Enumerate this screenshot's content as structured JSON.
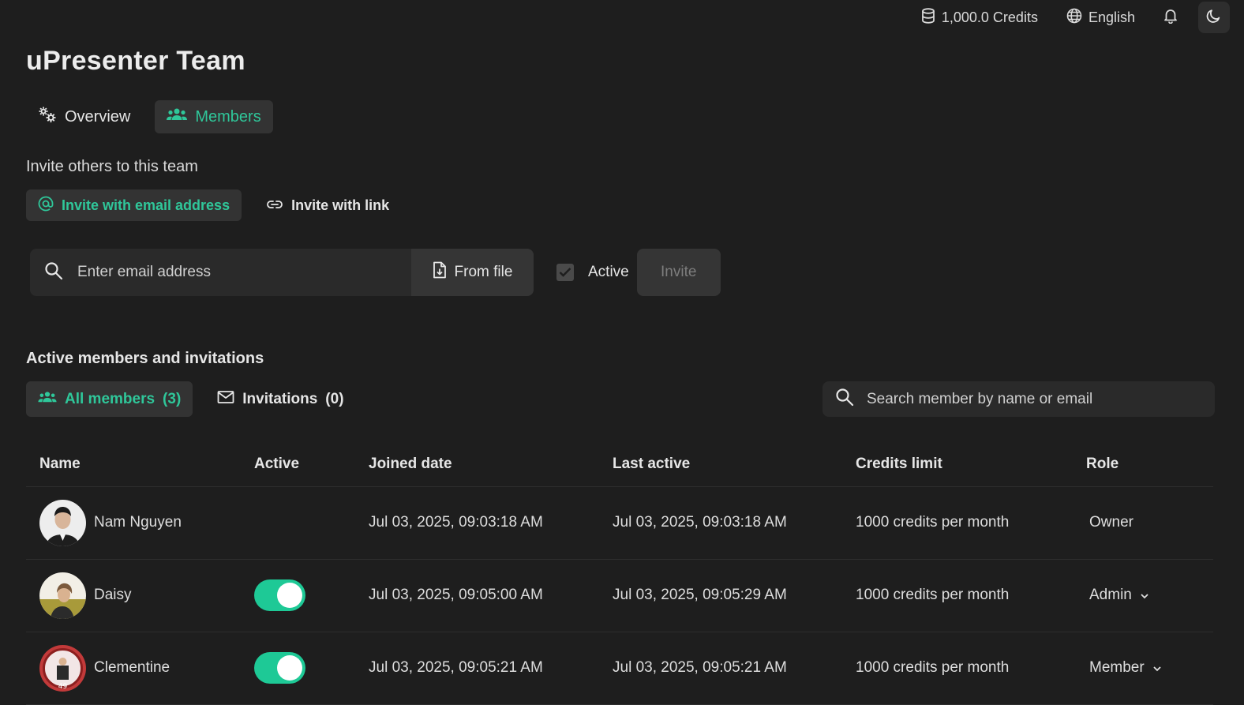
{
  "topbar": {
    "credits_label": "1,000.0 Credits",
    "language_label": "English",
    "icons": [
      "database-icon",
      "globe-icon",
      "bell-icon",
      "moon-icon"
    ]
  },
  "page": {
    "title": "uPresenter Team"
  },
  "tabs": [
    {
      "label": "Overview",
      "icon": "gears-icon",
      "active": false
    },
    {
      "label": "Members",
      "icon": "users-icon",
      "active": true
    }
  ],
  "invite": {
    "heading": "Invite others to this team",
    "modes": [
      {
        "label": "Invite with email address",
        "icon": "at-icon",
        "active": true
      },
      {
        "label": "Invite with link",
        "icon": "link-icon",
        "active": false
      }
    ],
    "email_placeholder": "Enter email address",
    "from_file_label": "From file",
    "active_label": "Active",
    "active_checked": true,
    "invite_button_label": "Invite"
  },
  "members_section": {
    "heading": "Active members and invitations",
    "filters": [
      {
        "label": "All members",
        "count": "(3)",
        "icon": "users-icon",
        "active": true
      },
      {
        "label": "Invitations",
        "count": "(0)",
        "icon": "mail-icon",
        "active": false
      }
    ],
    "search_placeholder": "Search member by name or email",
    "columns": [
      "Name",
      "Active",
      "Joined date",
      "Last active",
      "Credits limit",
      "Role"
    ],
    "rows": [
      {
        "name": "Nam Nguyen",
        "active": null,
        "joined": "Jul 03, 2025, 09:03:18 AM",
        "last_active": "Jul 03, 2025, 09:03:18 AM",
        "credits": "1000 credits per month",
        "role": "Owner",
        "role_editable": false
      },
      {
        "name": "Daisy",
        "active": true,
        "joined": "Jul 03, 2025, 09:05:00 AM",
        "last_active": "Jul 03, 2025, 09:05:29 AM",
        "credits": "1000 credits per month",
        "role": "Admin",
        "role_editable": true
      },
      {
        "name": "Clementine",
        "active": true,
        "joined": "Jul 03, 2025, 09:05:21 AM",
        "last_active": "Jul 03, 2025, 09:05:21 AM",
        "credits": "1000 credits per month",
        "role": "Member",
        "role_editable": true
      }
    ]
  },
  "colors": {
    "background": "#1e1e1e",
    "accent": "#2fc79a",
    "toggle_on": "#1ec996",
    "surface": "#2a2a2a"
  }
}
